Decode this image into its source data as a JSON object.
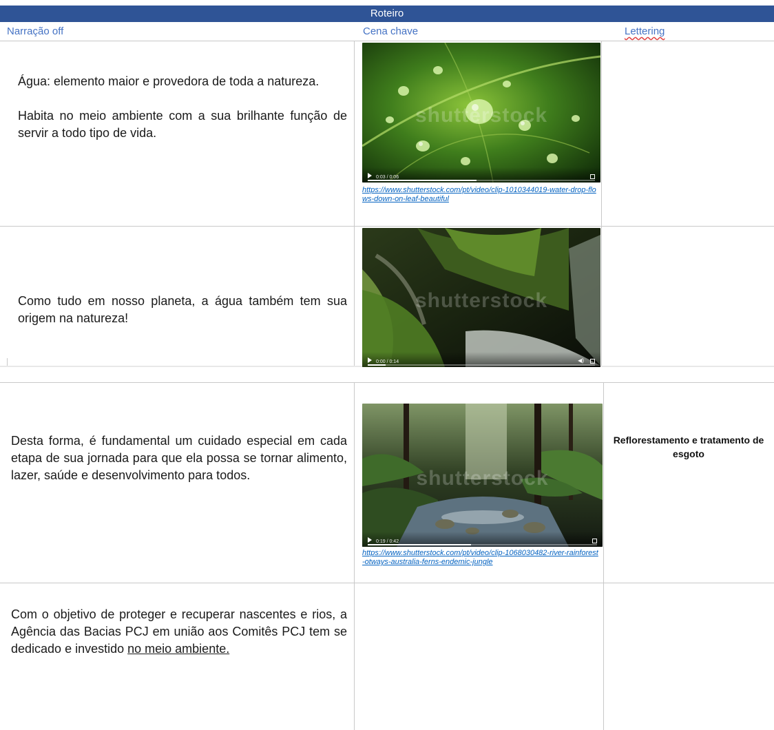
{
  "table": {
    "title": "Roteiro",
    "headers": {
      "narration": "Narração off",
      "scene": "Cena chave",
      "lettering": "Lettering"
    },
    "rows": [
      {
        "narration": [
          "Água: elemento maior e provedora de toda a natureza.",
          "Habita no meio ambiente com a sua brilhante função de servir a todo tipo de vida."
        ],
        "video_time": "0:03 / 0:06",
        "watermark": "shutterstock",
        "link": "https://www.shutterstock.com/pt/video/clip-1010344019-water-drop-flows-down-on-leaf-beautiful",
        "lettering": ""
      },
      {
        "narration": [
          "Como tudo em nosso planeta, a água também tem sua origem na natureza!"
        ],
        "video_time": "0:00 / 0:14",
        "watermark": "shutterstock",
        "link": "",
        "lettering": ""
      },
      {
        "narration": [
          "Desta forma, é fundamental um cuidado especial em cada etapa de sua jornada para que ela possa se tornar alimento, lazer, saúde e desenvolvimento para todos."
        ],
        "video_time": "0:19 / 0:42",
        "watermark": "shutterstock",
        "link": "https://www.shutterstock.com/pt/video/clip-1068030482-river-rainforest-otways-australia-ferns-endemic-jungle",
        "lettering": "Reflorestamento e tratamento de esgoto"
      },
      {
        "narration_prefix": "Com o objetivo de proteger e recuperar nascentes e rios, a Agência das Bacias PCJ em união aos Comitês PCJ tem se dedicado e investido ",
        "narration_underlined": "no meio ambiente.",
        "lettering": ""
      }
    ]
  }
}
